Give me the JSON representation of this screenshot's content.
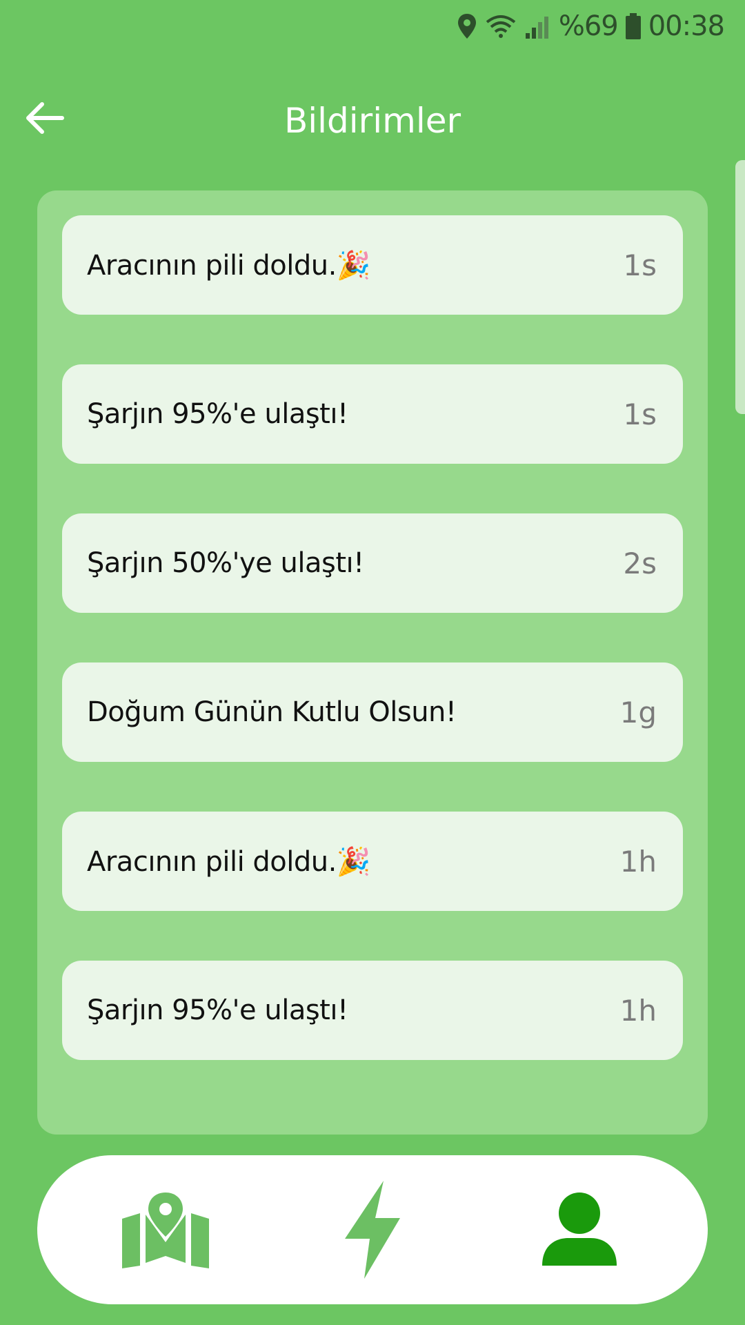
{
  "status_bar": {
    "battery_text": "%69",
    "time": "00:38",
    "icons": [
      "location-icon",
      "wifi-icon",
      "signal-icon",
      "battery-icon"
    ]
  },
  "header": {
    "title": "Bildirimler",
    "back_icon": "arrow-left-icon"
  },
  "notifications": [
    {
      "message": "Aracının pili doldu.🎉",
      "time": "1s"
    },
    {
      "message": "Şarjın 95%'e ulaştı!",
      "time": "1s"
    },
    {
      "message": "Şarjın 50%'ye ulaştı!",
      "time": "2s"
    },
    {
      "message": "Doğum Günün Kutlu Olsun!",
      "time": "1g"
    },
    {
      "message": "Aracının pili doldu.🎉",
      "time": "1h"
    },
    {
      "message": "Şarjın 95%'e ulaştı!",
      "time": "1h"
    }
  ],
  "bottom_nav": {
    "items": [
      {
        "icon": "map-icon",
        "active": false
      },
      {
        "icon": "lightning-icon",
        "active": false
      },
      {
        "icon": "profile-icon",
        "active": true
      }
    ]
  },
  "colors": {
    "background": "#6cc662",
    "panel": "#97d98c",
    "card": "#eaf6e8",
    "nav_icon_inactive": "#6cbf63",
    "nav_icon_active": "#1a9a0c"
  }
}
